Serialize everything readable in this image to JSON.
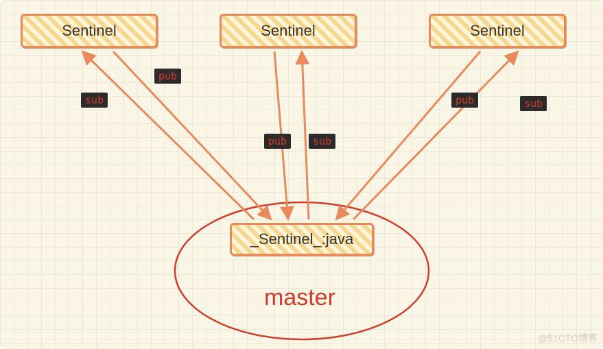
{
  "sentinels": [
    {
      "label": "Sentinel"
    },
    {
      "label": "Sentinel"
    },
    {
      "label": "Sentinel"
    }
  ],
  "channel": {
    "label": "_Sentinel_:java"
  },
  "master_label": "master",
  "tags": {
    "s1_sub": "sub",
    "s1_pub": "pub",
    "s2_pub": "pub",
    "s2_sub": "sub",
    "s3_pub": "pub",
    "s3_sub": "sub"
  },
  "watermark": "@51CTO博客",
  "colors": {
    "stroke": "#e88a5a",
    "ellipse": "#d23a2a"
  }
}
